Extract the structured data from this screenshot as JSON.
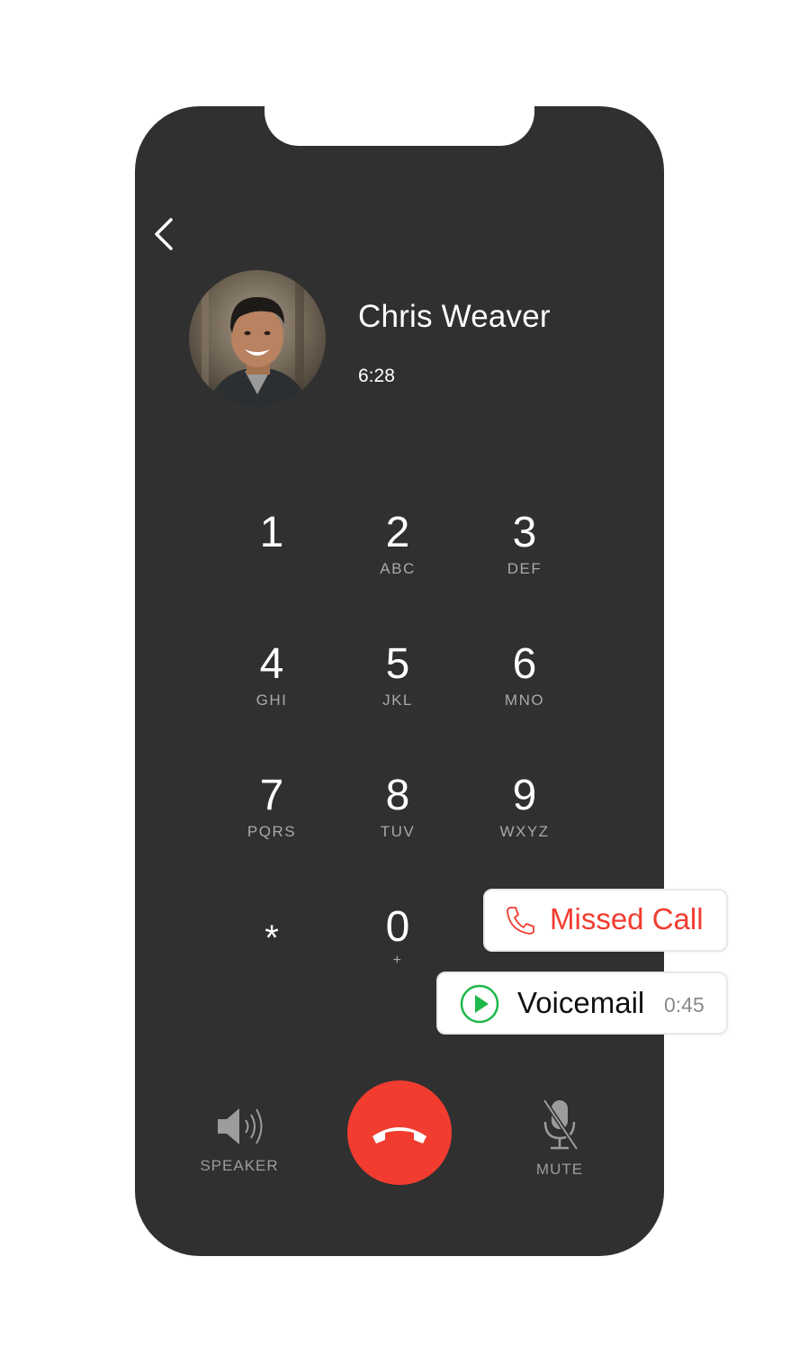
{
  "contact": {
    "name": "Chris Weaver",
    "call_duration": "6:28"
  },
  "keypad": [
    {
      "digit": "1",
      "letters": ""
    },
    {
      "digit": "2",
      "letters": "ABC"
    },
    {
      "digit": "3",
      "letters": "DEF"
    },
    {
      "digit": "4",
      "letters": "GHI"
    },
    {
      "digit": "5",
      "letters": "JKL"
    },
    {
      "digit": "6",
      "letters": "MNO"
    },
    {
      "digit": "7",
      "letters": "PQRS"
    },
    {
      "digit": "8",
      "letters": "TUV"
    },
    {
      "digit": "9",
      "letters": "WXYZ"
    },
    {
      "digit": "*",
      "letters": ""
    },
    {
      "digit": "0",
      "letters": "+"
    }
  ],
  "controls": {
    "speaker_label": "SPEAKER",
    "mute_label": "MUTE"
  },
  "notifications": {
    "missed_call": "Missed Call",
    "voicemail": "Voicemail",
    "voicemail_duration": "0:45"
  },
  "colors": {
    "end_call": "#f23c30",
    "missed_call": "#f23c30",
    "voicemail_play": "#1fb84a",
    "phone_body": "#303030"
  },
  "icons": [
    "back-chevron-icon",
    "speaker-icon",
    "end-call-icon",
    "mic-muted-icon",
    "phone-missed-icon",
    "play-icon"
  ]
}
